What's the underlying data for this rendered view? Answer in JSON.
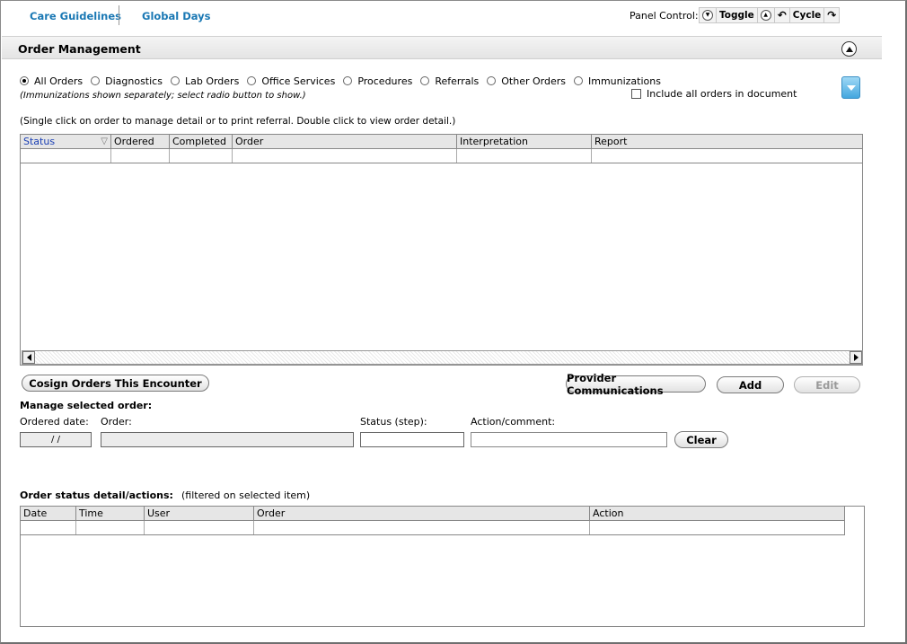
{
  "nav": {
    "tabs": [
      {
        "label": "Care Guidelines"
      },
      {
        "label": "Global Days"
      }
    ],
    "panel_control": {
      "label": "Panel Control:",
      "toggle_label": "Toggle",
      "cycle_label": "Cycle"
    }
  },
  "header": {
    "title": "Order Management"
  },
  "filters": {
    "options": [
      {
        "label": "All Orders",
        "checked": true
      },
      {
        "label": "Diagnostics",
        "checked": false
      },
      {
        "label": "Lab Orders",
        "checked": false
      },
      {
        "label": "Office Services",
        "checked": false
      },
      {
        "label": "Procedures",
        "checked": false
      },
      {
        "label": "Referrals",
        "checked": false
      },
      {
        "label": "Other Orders",
        "checked": false
      },
      {
        "label": "Immunizations",
        "checked": false
      }
    ],
    "note": "(Immunizations shown separately; select radio button to show.)",
    "include_all_label": "Include all orders in document"
  },
  "instructions": "(Single click on order to manage detail or to print referral. Double click to view order detail.)",
  "orders_table": {
    "columns": [
      "Status",
      "Ordered",
      "Completed",
      "Order",
      "Interpretation",
      "Report"
    ],
    "rows": []
  },
  "buttons": {
    "cosign": "Cosign Orders This Encounter",
    "provider_comm": "Provider Communications",
    "add": "Add",
    "edit": "Edit",
    "clear": "Clear"
  },
  "manage": {
    "title": "Manage selected order:",
    "ordered_date_label": "Ordered date:",
    "ordered_date_value": "/ /",
    "order_label": "Order:",
    "status_label": "Status (step):",
    "action_label": "Action/comment:"
  },
  "status_detail": {
    "title": "Order status detail/actions:",
    "filter_note": "(filtered on selected item)",
    "columns": [
      "Date",
      "Time",
      "User",
      "Order",
      "Action"
    ]
  },
  "colors": {
    "link": "#1a78b4",
    "accent_blue": "#44a7df"
  }
}
